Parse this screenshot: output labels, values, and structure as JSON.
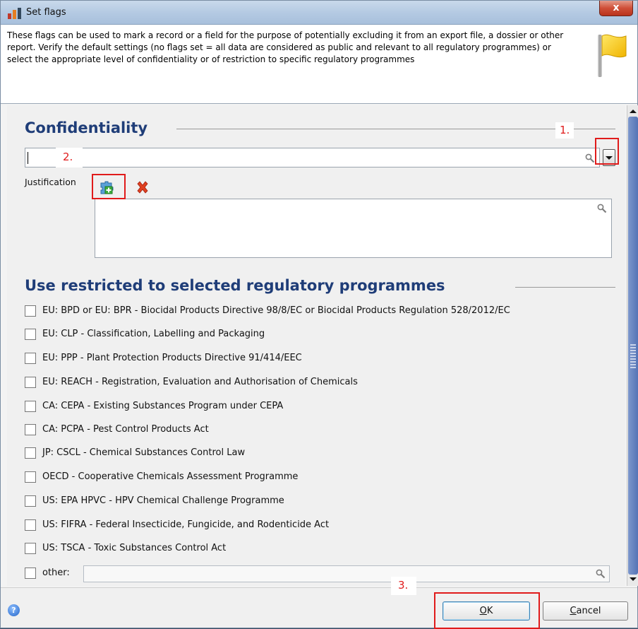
{
  "window": {
    "title": "Set flags",
    "close_glyph": "x"
  },
  "info": {
    "text": "These flags can be used to mark a record or a field for the purpose of potentially excluding it from an export file, a dossier or other report. Verify the default settings (no flags set = all data are considered as public and relevant to all regulatory programmes) or select the appropriate level of confidentiality or of restriction to specific regulatory programmes"
  },
  "confidentiality": {
    "heading": "Confidentiality",
    "value": "",
    "justification_label": "Justification",
    "justification_value": ""
  },
  "regulatory": {
    "heading": "Use restricted to selected regulatory programmes",
    "options": [
      {
        "label": "EU: BPD or EU: BPR - Biocidal Products Directive 98/8/EC or Biocidal Products Regulation 528/2012/EC",
        "checked": false
      },
      {
        "label": "EU: CLP - Classification, Labelling and Packaging",
        "checked": false
      },
      {
        "label": "EU: PPP - Plant Protection Products Directive 91/414/EEC",
        "checked": false
      },
      {
        "label": "EU: REACH - Registration, Evaluation and Authorisation of Chemicals",
        "checked": false
      },
      {
        "label": "CA: CEPA - Existing Substances Program under CEPA",
        "checked": false
      },
      {
        "label": "CA: PCPA - Pest Control Products Act",
        "checked": false
      },
      {
        "label": "JP: CSCL - Chemical Substances Control Law",
        "checked": false
      },
      {
        "label": "OECD - Cooperative Chemicals Assessment Programme",
        "checked": false
      },
      {
        "label": "US: EPA HPVC - HPV Chemical Challenge Programme",
        "checked": false
      },
      {
        "label": "US: FIFRA - Federal Insecticide, Fungicide, and Rodenticide Act",
        "checked": false
      },
      {
        "label": "US: TSCA - Toxic Substances Control Act",
        "checked": false
      }
    ],
    "other_label": "other:",
    "other_value": ""
  },
  "footer": {
    "ok_mnemonic": "O",
    "ok_rest": "K",
    "cancel_mnemonic": "C",
    "cancel_rest": "ancel",
    "help_glyph": "?"
  },
  "annotations": {
    "step1": "1.",
    "step2": "2.",
    "step3": "3."
  },
  "colors": {
    "heading": "#1f3d78",
    "annotation": "#e01b1b",
    "title_bar": "#b3c9e2"
  }
}
